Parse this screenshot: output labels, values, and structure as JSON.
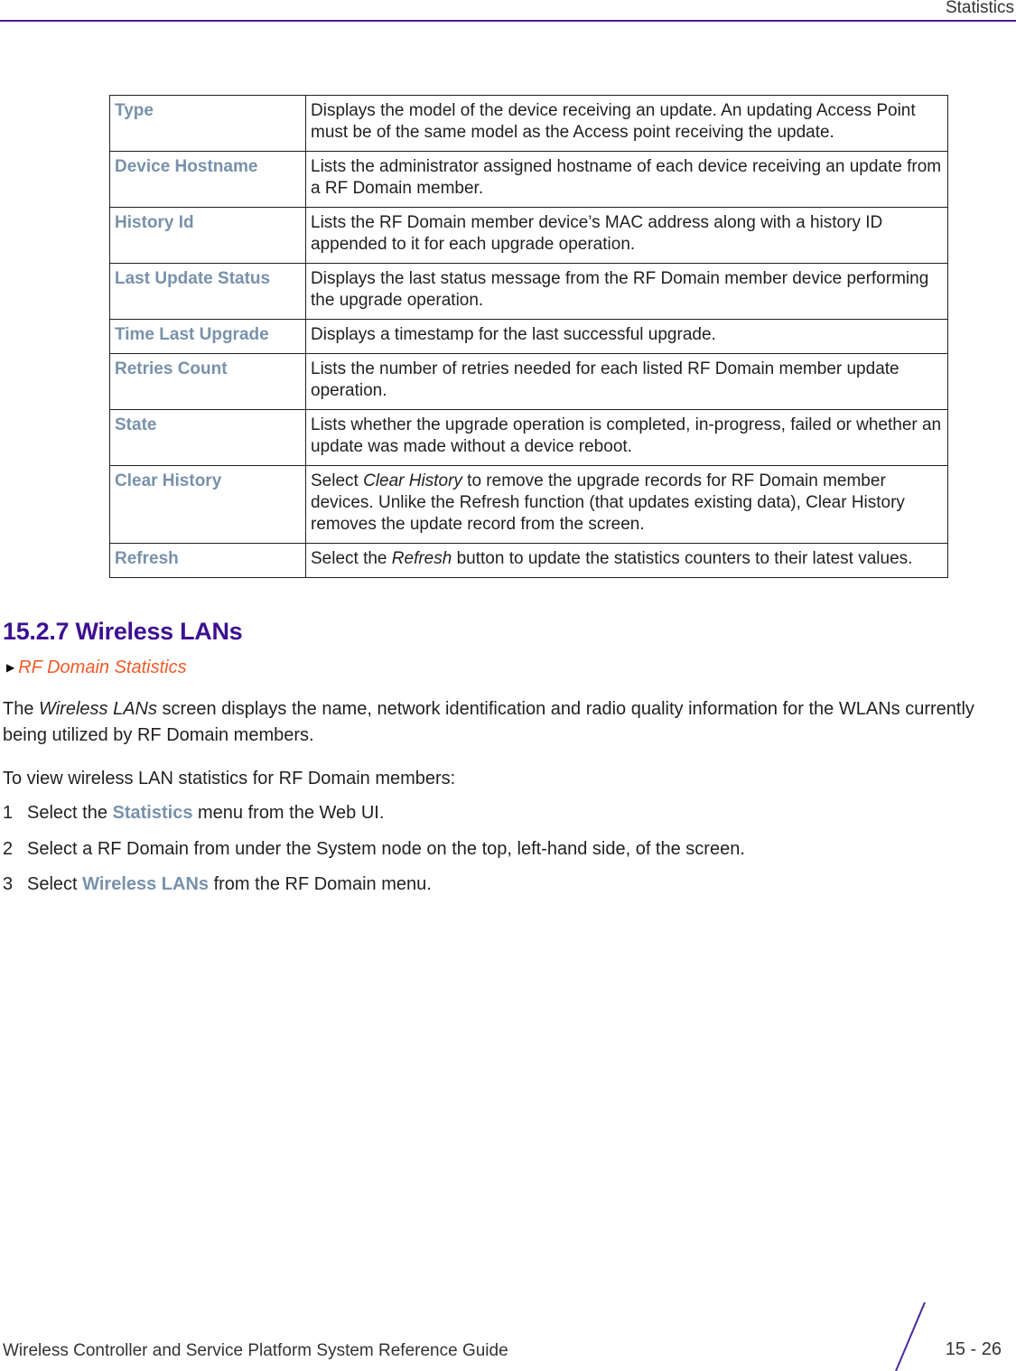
{
  "header": {
    "title": "Statistics"
  },
  "table": {
    "rows": [
      {
        "term": "Type",
        "desc": [
          "Displays the model of the device receiving an update. An updating Access Point must be of the same model as the Access point receiving the update."
        ]
      },
      {
        "term": "Device Hostname",
        "desc": [
          "Lists the administrator assigned hostname of each device receiving an update from a RF Domain member."
        ]
      },
      {
        "term": "History Id",
        "desc": [
          "Lists the RF Domain member device’s MAC address along with a history ID appended to it for each upgrade operation."
        ]
      },
      {
        "term": "Last Update Status",
        "desc": [
          "Displays the last status message from the RF Domain member device performing the upgrade operation."
        ]
      },
      {
        "term": "Time Last Upgrade",
        "desc": [
          "Displays a timestamp for the last successful upgrade."
        ]
      },
      {
        "term": "Retries Count",
        "desc": [
          "Lists the number of retries needed for each listed RF Domain member update operation."
        ]
      },
      {
        "term": "State",
        "desc": [
          "Lists whether the upgrade operation is completed, in-progress, failed or whether an update was made without a device reboot."
        ]
      },
      {
        "term": "Clear History",
        "desc_pre": "Select ",
        "desc_em": "Clear History",
        "desc_post": " to remove the upgrade records for RF Domain member devices. Unlike the Refresh function (that updates existing data), Clear History removes the update record from the screen."
      },
      {
        "term": "Refresh",
        "desc_pre": "Select the ",
        "desc_em": "Refresh",
        "desc_post": " button to update the statistics counters to their latest values."
      }
    ]
  },
  "section": {
    "heading": "15.2.7 Wireless LANs",
    "xref": "RF Domain Statistics",
    "intro_pre": "The ",
    "intro_em": "Wireless LANs",
    "intro_post": " screen displays the name, network identification and radio quality information for the WLANs currently being utilized by RF Domain members.",
    "lead": "To view wireless LAN statistics for RF Domain members:",
    "steps": [
      {
        "num": "1",
        "pre": "Select the ",
        "bold": "Statistics",
        "post": " menu from the Web UI."
      },
      {
        "num": "2",
        "pre": "Select a RF Domain from under the System node on the top, left-hand side, of the screen.",
        "bold": "",
        "post": ""
      },
      {
        "num": "3",
        "pre": "Select ",
        "bold": "Wireless LANs",
        "post": " from the RF Domain menu."
      }
    ]
  },
  "footer": {
    "guide_title": "Wireless Controller and Service Platform System Reference Guide",
    "page": "15 - 26"
  }
}
